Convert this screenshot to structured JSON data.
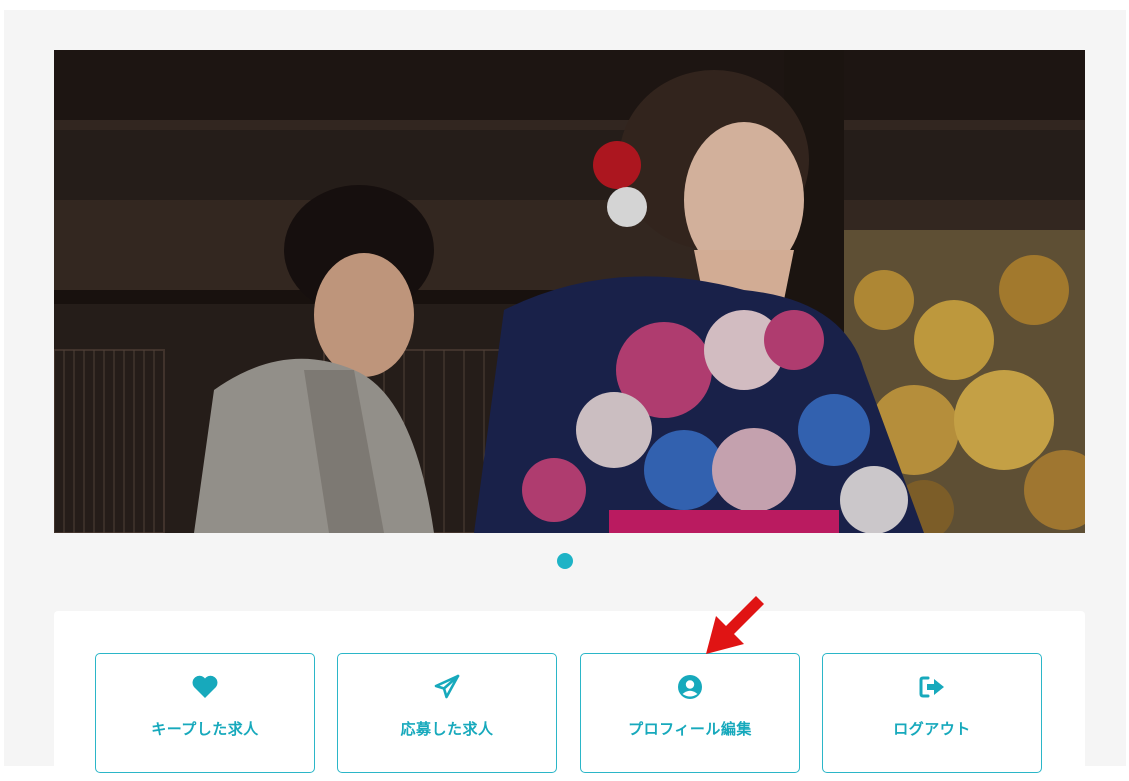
{
  "hero": {
    "description_icon": "kimono-photo",
    "slide_count": 1,
    "active_slide": 1
  },
  "menu": {
    "items": [
      {
        "label": "キープした求人",
        "icon": "heart-icon"
      },
      {
        "label": "応募した求人",
        "icon": "paper-plane-icon"
      },
      {
        "label": "プロフィール編集",
        "icon": "user-circle-icon"
      },
      {
        "label": "ログアウト",
        "icon": "sign-out-icon"
      }
    ]
  },
  "annotation": {
    "icon": "red-arrow-icon"
  },
  "colors": {
    "accent": "#1eb3c6",
    "arrow": "#e01414",
    "page_bg": "#f5f5f5"
  }
}
